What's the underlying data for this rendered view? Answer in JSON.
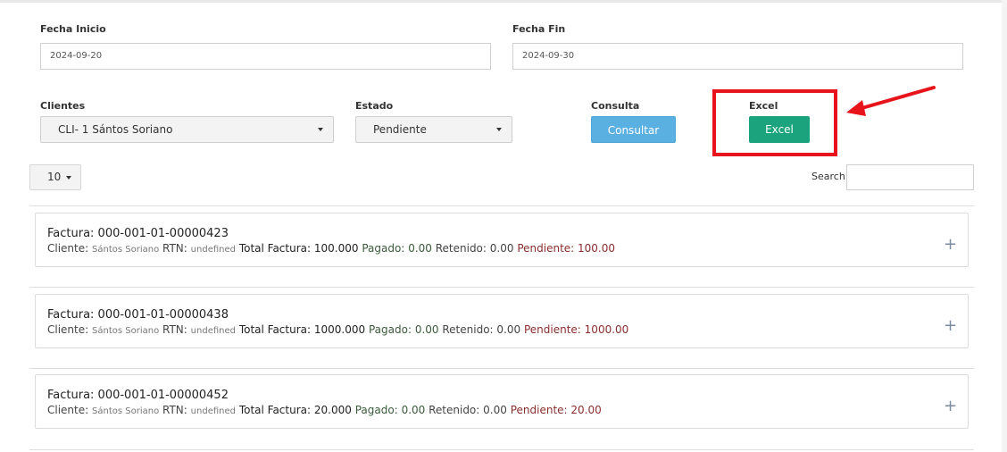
{
  "filters": {
    "fecha_inicio_label": "Fecha Inicio",
    "fecha_inicio_value": "2024-09-20",
    "fecha_fin_label": "Fecha Fin",
    "fecha_fin_value": "2024-09-30",
    "clientes_label": "Clientes",
    "clientes_value": "CLI- 1 Sántos Soriano",
    "estado_label": "Estado",
    "estado_value": "Pendiente",
    "consulta_label": "Consulta",
    "consulta_button": "Consultar",
    "excel_label": "Excel",
    "excel_button": "Excel"
  },
  "table": {
    "page_length": "10",
    "search_label": "Search:"
  },
  "labels": {
    "cliente": "Cliente:",
    "rtn": "RTN:",
    "total": "Total Factura:",
    "pagado": "Pagado:",
    "retenido": "Retenido:",
    "pendiente": "Pendiente:",
    "expand": "+"
  },
  "invoices": [
    {
      "title": "Factura: 000-001-01-00000423",
      "cliente": "Sántos Soriano",
      "rtn": "undefined",
      "total": "100.000",
      "pagado": "0.00",
      "retenido": "0.00",
      "pendiente": "100.00"
    },
    {
      "title": "Factura: 000-001-01-00000438",
      "cliente": "Sántos Soriano",
      "rtn": "undefined",
      "total": "1000.000",
      "pagado": "0.00",
      "retenido": "0.00",
      "pendiente": "1000.00"
    },
    {
      "title": "Factura: 000-001-01-00000452",
      "cliente": "Sántos Soriano",
      "rtn": "undefined",
      "total": "20.000",
      "pagado": "0.00",
      "retenido": "0.00",
      "pendiente": "20.00"
    }
  ],
  "colors": {
    "excel_button": "#1aa37d",
    "consultar_button": "#5bb0e2",
    "highlight": "#e8141c",
    "pending_text": "#8b2e2e"
  }
}
